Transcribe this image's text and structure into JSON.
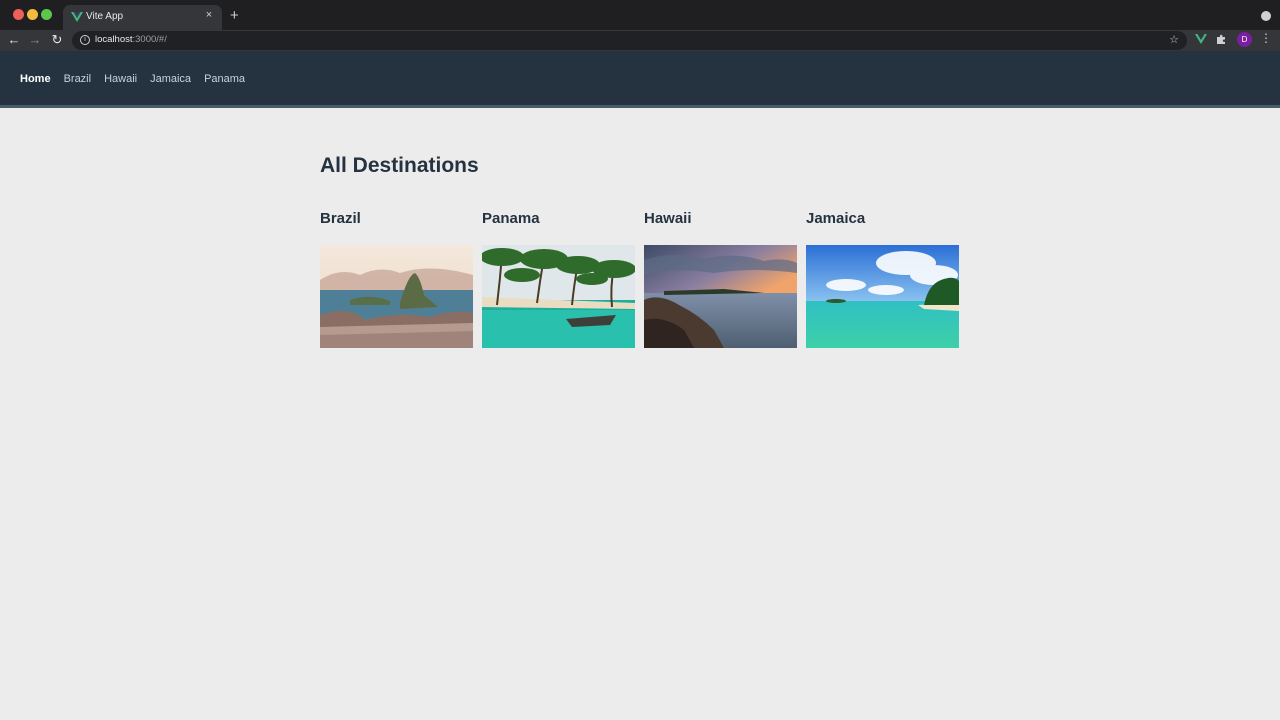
{
  "browser": {
    "tab_title": "Vite App",
    "new_tab_label": "+",
    "close_tab_label": "×",
    "url_host": "localhost",
    "url_rest": ":3000/#/",
    "profile_initial": "D"
  },
  "nav": {
    "items": [
      "Home",
      "Brazil",
      "Hawaii",
      "Jamaica",
      "Panama"
    ],
    "active": "Home"
  },
  "page": {
    "title": "All Destinations"
  },
  "destinations": [
    {
      "name": "Brazil",
      "image": "rio-de-janeiro-photo"
    },
    {
      "name": "Panama",
      "image": "tropical-beach-boat-photo"
    },
    {
      "name": "Hawaii",
      "image": "sunset-rocky-coast-photo"
    },
    {
      "name": "Jamaica",
      "image": "turquoise-lagoon-photo"
    }
  ],
  "colors": {
    "header_bg": "#253341",
    "page_bg": "#ececec",
    "heading": "#253341"
  }
}
